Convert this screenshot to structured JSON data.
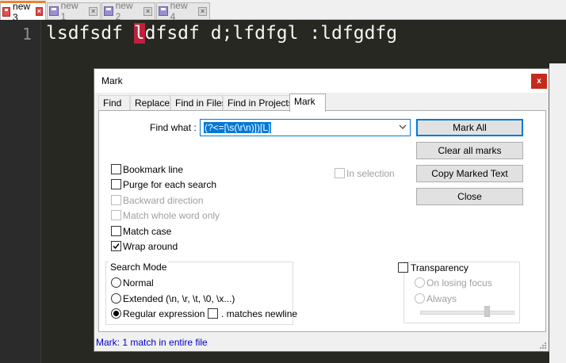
{
  "editor": {
    "tabs": [
      {
        "label": "new 3",
        "active": true
      },
      {
        "label": "new 1",
        "active": false
      },
      {
        "label": "new 2",
        "active": false
      },
      {
        "label": "new 4",
        "active": false
      }
    ],
    "line_number": "1",
    "code_before": "lsdfsdf ",
    "code_caret_char": "l",
    "code_after": "dfsdf d;lfdfgl :ldfgdfg"
  },
  "dialog": {
    "title": "Mark",
    "close_glyph": "x",
    "tabs": [
      "Find",
      "Replace",
      "Find in Files",
      "Find in Projects",
      "Mark"
    ],
    "active_tab": "Mark",
    "find_what_label": "Find what :",
    "find_what_value": "(?<=[\\s(\\r\\n)])[L]",
    "buttons": {
      "mark_all": "Mark All",
      "clear_all_marks": "Clear all marks",
      "copy_marked_text": "Copy Marked Text",
      "close": "Close"
    },
    "options": {
      "bookmark_line": {
        "label": "Bookmark line",
        "checked": false,
        "enabled": true
      },
      "purge": {
        "label": "Purge for each search",
        "checked": false,
        "enabled": true
      },
      "backward": {
        "label": "Backward direction",
        "checked": false,
        "enabled": false
      },
      "whole_word": {
        "label": "Match whole word only",
        "checked": false,
        "enabled": false
      },
      "match_case": {
        "label": "Match case",
        "checked": false,
        "enabled": true
      },
      "wrap_around": {
        "label": "Wrap around",
        "checked": true,
        "enabled": true
      },
      "in_selection": {
        "label": "In selection",
        "checked": false,
        "enabled": false
      }
    },
    "search_mode": {
      "title": "Search Mode",
      "normal": "Normal",
      "extended": "Extended (\\n, \\r, \\t, \\0, \\x...)",
      "regex": "Regular expression",
      "selected": "regex",
      "dot_newline": ". matches newline"
    },
    "transparency": {
      "label": "Transparency",
      "checked": false,
      "on_losing_focus": "On losing focus",
      "always": "Always",
      "level": 0.72
    },
    "status": "Mark: 1 match in entire file"
  },
  "colors": {
    "editor_bg": "#272822",
    "accent": "#0078d7",
    "status_text": "#0000cc",
    "close_red": "#c42b1c"
  }
}
